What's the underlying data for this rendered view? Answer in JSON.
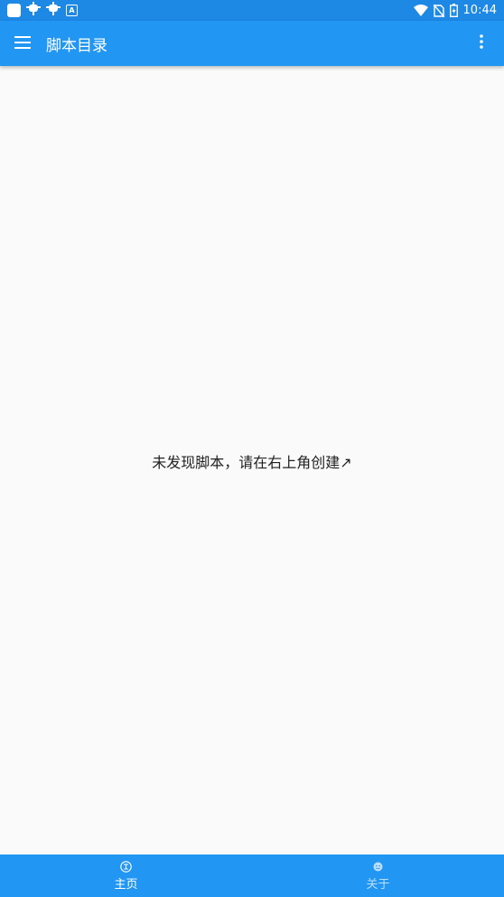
{
  "status_bar": {
    "time": "10:44",
    "left_icons": [
      "app-square-icon",
      "bug-icon",
      "bug-icon",
      "a-notification-icon"
    ],
    "right_icons": [
      "wifi-icon",
      "no-sim-icon",
      "battery-icon"
    ],
    "color": "#1e88e5"
  },
  "app_bar": {
    "title": "脚本目录",
    "color": "#2196f3",
    "menu_icon": "menu-icon",
    "overflow_icon": "more-vert-icon"
  },
  "main": {
    "empty_message": "未发现脚本，请在右上角创建↗"
  },
  "bottom_nav": {
    "color": "#2196f3",
    "items": [
      {
        "label": "主页",
        "icon": "write-icon",
        "active": true
      },
      {
        "label": "关于",
        "icon": "smiley-icon",
        "active": false
      }
    ]
  }
}
